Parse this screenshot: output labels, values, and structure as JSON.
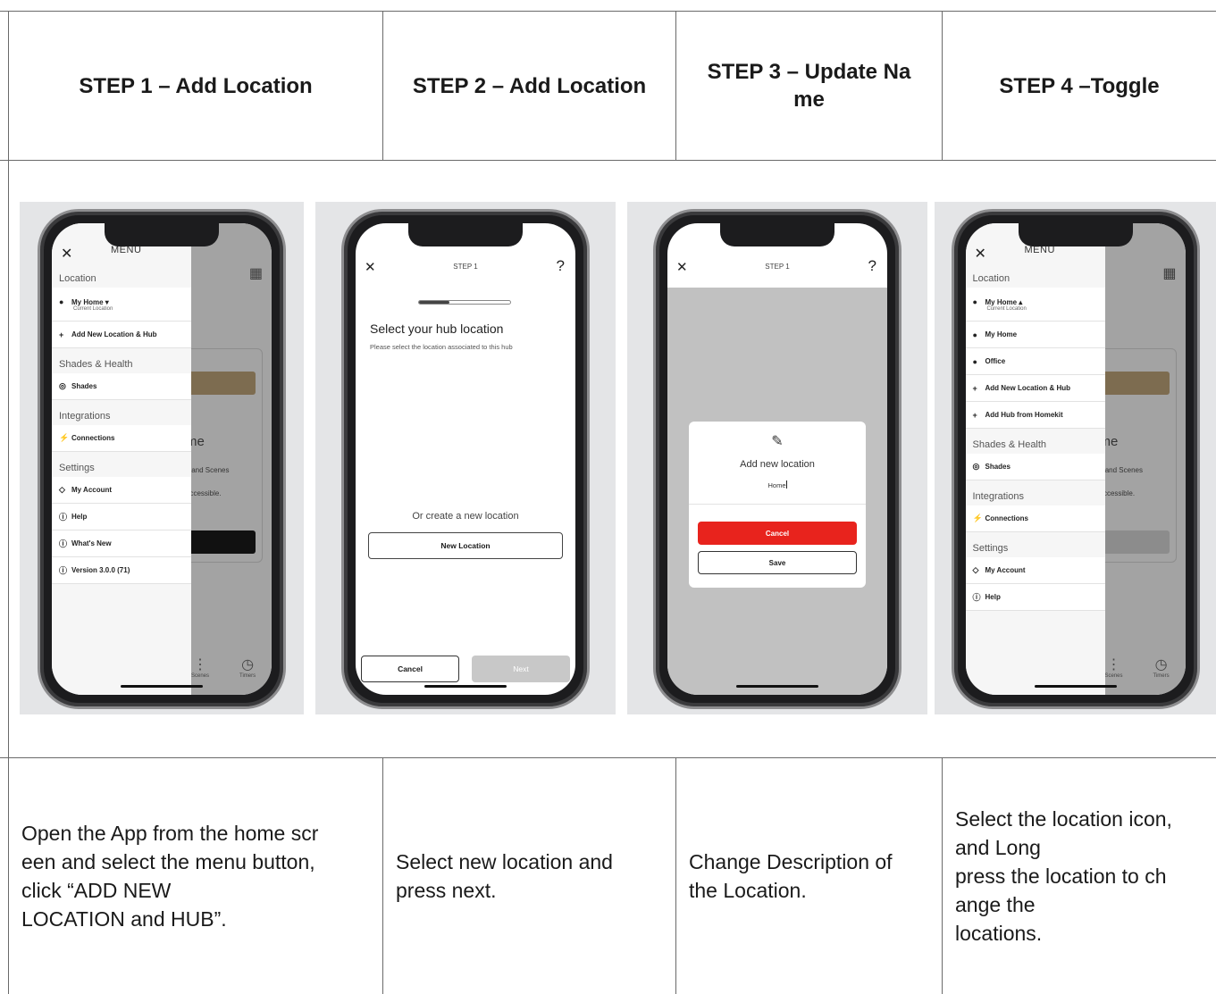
{
  "headers": [
    "STEP 1 – Add Location",
    "STEP 2 – Add Location",
    "STEP 3 – Update Na\nme",
    "STEP 4 –Toggle"
  ],
  "descriptions": [
    "Open the App from the home scr\neen and select the menu button,\nclick “ADD NEW\nLOCATION and HUB”.",
    "Select new location and\npress next.",
    "Change Description of\nthe Location.",
    "Select the location icon,\nand Long\npress the location to ch\nange the\nlocations."
  ],
  "icons": {
    "close": "✕",
    "help": "?",
    "grid": "▦",
    "pin": "●",
    "plus": "+",
    "shades": "◎",
    "plug": "⚡",
    "user": "◇",
    "help_circle": "ⓘ",
    "pencil": "✎",
    "dots": "⋮",
    "timer": "◷"
  },
  "step1": {
    "menu_title": "MENU",
    "bg_home": "me",
    "bg_sub1": "s and Scenes",
    "bg_sub2": "accessible.",
    "bg_tab1": "Scenes",
    "bg_tab2": "Timers",
    "sec_location": "Location",
    "loc_name": "My Home",
    "loc_caret": "▾",
    "loc_sub": "Current Location",
    "add_new": "Add New Location & Hub",
    "sec_shades": "Shades & Health",
    "shades": "Shades",
    "sec_integrations": "Integrations",
    "connections": "Connections",
    "sec_settings": "Settings",
    "my_account": "My Account",
    "help": "Help",
    "whats_new": "What's New",
    "version": "Version 3.0.0 (71)"
  },
  "step2": {
    "title": "STEP 1",
    "progress": 0.33,
    "heading": "Select your hub location",
    "subtext": "Please select the location associated to this hub",
    "or_text": "Or create a new location",
    "new_location": "New Location",
    "cancel": "Cancel",
    "next": "Next"
  },
  "step3": {
    "title": "STEP 1",
    "modal_title": "Add new location",
    "value": "Home",
    "cancel": "Cancel",
    "save": "Save",
    "cancel_color": "#e8231d"
  },
  "step4": {
    "menu_title": "MENU",
    "sec_location": "Location",
    "loc_name": "My Home",
    "loc_caret": "▴",
    "loc_sub": "Current Location",
    "item_home": "My Home",
    "item_office": "Office",
    "add_new": "Add New Location & Hub",
    "add_homekit": "Add Hub from Homekit",
    "sec_shades": "Shades & Health",
    "shades": "Shades",
    "sec_integrations": "Integrations",
    "connections": "Connections",
    "sec_settings": "Settings",
    "my_account": "My Account",
    "help": "Help"
  }
}
